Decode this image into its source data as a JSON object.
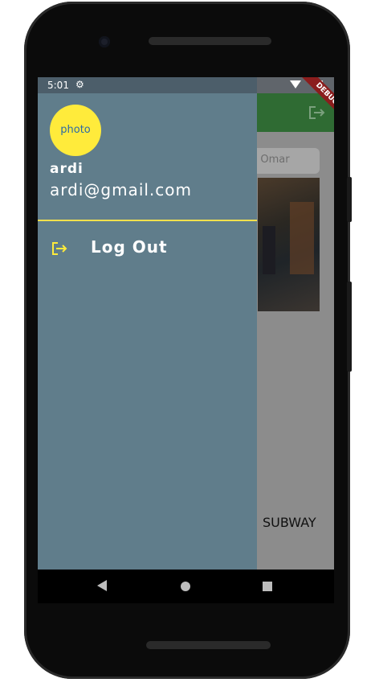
{
  "status_bar": {
    "time": "5:01",
    "gear_icon": "settings-icon",
    "wifi_icon": "wifi-icon",
    "battery_icon": "battery-icon"
  },
  "debug_banner": "DEBUG",
  "background_app": {
    "search_text": "d Omar",
    "list_label": "SUBWAY",
    "appbar_color": "#2f6b33",
    "exit_icon": "logout-icon"
  },
  "drawer": {
    "avatar_text": "photo",
    "account_name": "ardi",
    "account_email": "ardi@gmail.com",
    "menu_items": [
      {
        "label": "Log Out",
        "icon": "logout-icon"
      }
    ],
    "background_color": "#607d8b",
    "accent_color": "#ffeb3b"
  },
  "nav_bar": {
    "back_icon": "back-icon",
    "home_icon": "home-icon",
    "recents_icon": "recents-icon"
  }
}
